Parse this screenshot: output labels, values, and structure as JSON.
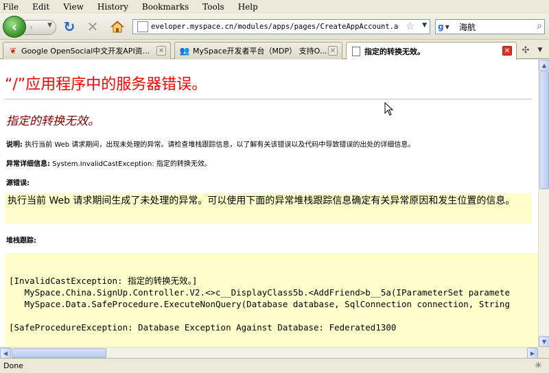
{
  "menu": [
    "File",
    "Edit",
    "View",
    "History",
    "Bookmarks",
    "Tools",
    "Help"
  ],
  "nav": {
    "back_glyph": "‹",
    "forward_glyph": "›",
    "url": "eveloper.myspace.cn/modules/apps/pages/CreateAppAccount.aspx",
    "search_engine": "g",
    "search_text": "海航"
  },
  "tabs": [
    {
      "title": "Google OpenSocial中文开发API资...",
      "icon": "opensocial-icon"
    },
    {
      "title": "MySpace开发者平台（MDP） 支持O...",
      "icon": "myspace-icon"
    },
    {
      "title": "指定的转换无效。",
      "icon": "page-icon",
      "active": true
    }
  ],
  "page": {
    "title": "“/”应用程序中的服务器错误。",
    "subtitle": "指定的转换无效。",
    "description_label": "说明:",
    "description_text": " 执行当前 Web 请求期间，出现未处理的异常。请检查堆栈跟踪信息，以了解有关该错误以及代码中导致错误的出处的详细信息。",
    "exception_label": "异常详细信息:",
    "exception_text": " System.InvalidCastException: 指定的转换无效。",
    "source_label": "源错误:",
    "source_text": "执行当前 Web 请求期间生成了未处理的异常。可以使用下面的异常堆栈跟踪信息确定有关异常原因和发生位置的信息。",
    "stack_label": "堆栈跟踪:",
    "stack_text": "[InvalidCastException: 指定的转换无效。]\n   MySpace.China.SignUp.Controller.V2.<>c__DisplayClass5b.<AddFriend>b__5a(IParameterSet paramete\n   MySpace.Data.SafeProcedure.ExecuteNonQuery(Database database, SqlConnection connection, String\n\n[SafeProcedureException: Database Exception Against Database: Federated1300"
  },
  "status": {
    "text": "Done"
  }
}
